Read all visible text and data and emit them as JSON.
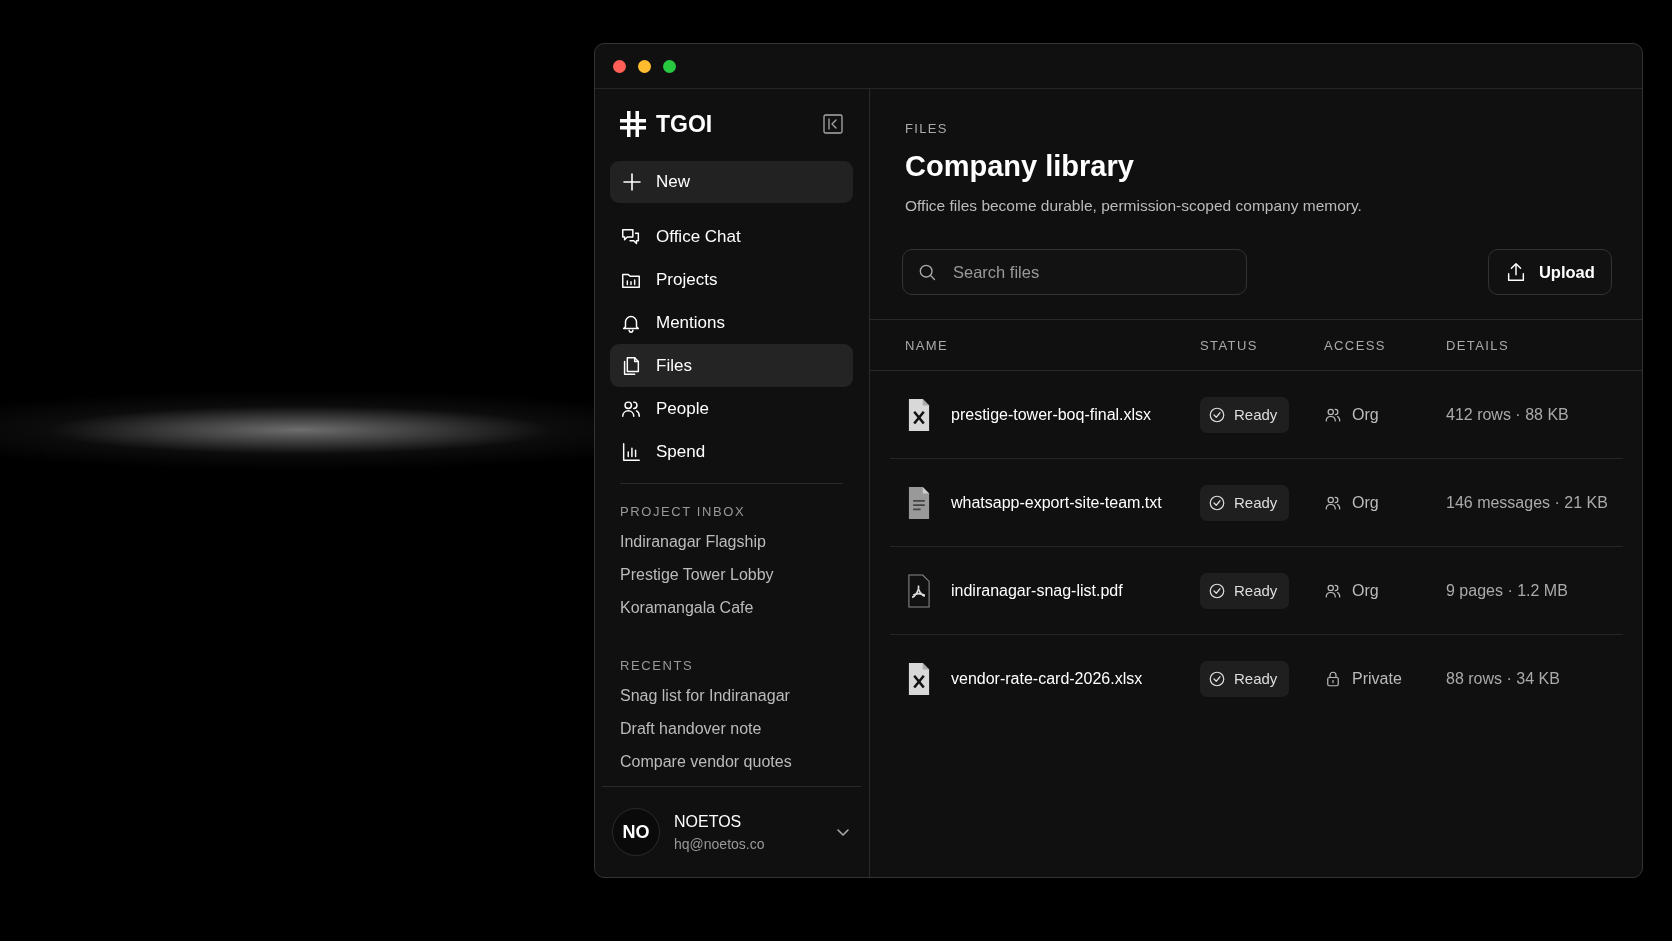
{
  "window": {
    "controls": [
      {
        "color": "#ff5f57"
      },
      {
        "color": "#febc2e"
      },
      {
        "color": "#28c840"
      }
    ]
  },
  "sidebar": {
    "brand": "TGOI",
    "new_button": "New",
    "nav": [
      {
        "label": "Office Chat",
        "selected": false
      },
      {
        "label": "Projects",
        "selected": false
      },
      {
        "label": "Mentions",
        "selected": false
      },
      {
        "label": "Files",
        "selected": true
      },
      {
        "label": "People",
        "selected": false
      },
      {
        "label": "Spend",
        "selected": false
      }
    ],
    "sections": [
      {
        "title": "PROJECT INBOX",
        "items": [
          "Indiranagar Flagship",
          "Prestige Tower Lobby",
          "Koramangala Cafe"
        ]
      },
      {
        "title": "RECENTS",
        "items": [
          "Snag list for Indiranagar",
          "Draft handover note",
          "Compare vendor quotes"
        ]
      }
    ],
    "user": {
      "initials": "NO",
      "name": "NOETOS",
      "email": "hq@noetos.co"
    }
  },
  "main": {
    "eyebrow": "FILES",
    "title": "Company library",
    "subtitle": "Office files become durable, permission-scoped company memory.",
    "search": {
      "placeholder": "Search files"
    },
    "upload_button": "Upload",
    "table": {
      "columns": [
        "NAME",
        "STATUS",
        "ACCESS",
        "DETAILS"
      ],
      "rows": [
        {
          "kind": "xlsx",
          "name": "prestige-tower-boq-final.xlsx",
          "status": "Ready",
          "access": {
            "label": "Org",
            "kind": "group"
          },
          "details": "412 rows · 88 KB"
        },
        {
          "kind": "txt",
          "name": "whatsapp-export-site-team.txt",
          "status": "Ready",
          "access": {
            "label": "Org",
            "kind": "group"
          },
          "details": "146 messages · 21 KB"
        },
        {
          "kind": "pdf",
          "name": "indiranagar-snag-list.pdf",
          "status": "Ready",
          "access": {
            "label": "Org",
            "kind": "group"
          },
          "details": "9 pages · 1.2 MB"
        },
        {
          "kind": "xlsx",
          "name": "vendor-rate-card-2026.xlsx",
          "status": "Ready",
          "access": {
            "label": "Private",
            "kind": "locked"
          },
          "details": "88 rows · 34 KB"
        }
      ]
    }
  }
}
